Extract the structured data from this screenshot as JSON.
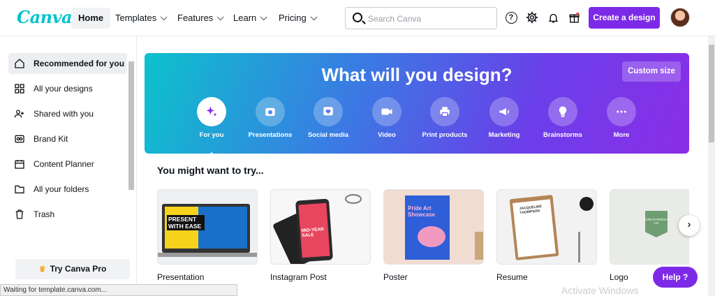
{
  "logo": "Canva",
  "nav": [
    {
      "label": "Home",
      "active": true
    },
    {
      "label": "Templates"
    },
    {
      "label": "Features"
    },
    {
      "label": "Learn"
    },
    {
      "label": "Pricing"
    }
  ],
  "search": {
    "placeholder": "Search Canva"
  },
  "header": {
    "create_label": "Create a design",
    "help_glyph": "?"
  },
  "sidebar": {
    "items": [
      {
        "label": "Recommended for you",
        "icon": "home-icon"
      },
      {
        "label": "All your designs",
        "icon": "grid-icon"
      },
      {
        "label": "Shared with you",
        "icon": "people-icon"
      },
      {
        "label": "Brand Kit",
        "icon": "brand-kit-icon"
      },
      {
        "label": "Content Planner",
        "icon": "calendar-icon"
      },
      {
        "label": "All your folders",
        "icon": "folder-icon"
      },
      {
        "label": "Trash",
        "icon": "trash-icon"
      }
    ],
    "try_pro": "Try Canva Pro"
  },
  "hero": {
    "title": "What will you design?",
    "custom_size": "Custom size",
    "categories": [
      {
        "label": "For you",
        "icon": "sparkle-icon"
      },
      {
        "label": "Presentations",
        "icon": "presentation-icon"
      },
      {
        "label": "Social media",
        "icon": "heart-icon"
      },
      {
        "label": "Video",
        "icon": "video-icon"
      },
      {
        "label": "Print products",
        "icon": "printer-icon"
      },
      {
        "label": "Marketing",
        "icon": "megaphone-icon"
      },
      {
        "label": "Brainstorms",
        "icon": "lightbulb-icon"
      },
      {
        "label": "More",
        "icon": "more-icon"
      }
    ]
  },
  "suggestions": {
    "title": "You might want to try...",
    "cards": [
      {
        "label": "Presentation",
        "thumb_text": "PRESENT WITH EASE"
      },
      {
        "label": "Instagram Post",
        "thumb_text": "MID-YEAR SALE"
      },
      {
        "label": "Poster",
        "thumb_text": "Pride Art Showcase"
      },
      {
        "label": "Resume",
        "thumb_text": "JACQUELINE THOMPSON"
      },
      {
        "label": "Logo",
        "thumb_text": "GRETA PRESH CO"
      }
    ]
  },
  "status_bar": "Waiting for template.canva.com...",
  "watermark": "Activate Windows",
  "help_button": "Help ?",
  "colors": {
    "brand_purple": "#7d2ae8",
    "logo_teal": "#00c4cc"
  }
}
